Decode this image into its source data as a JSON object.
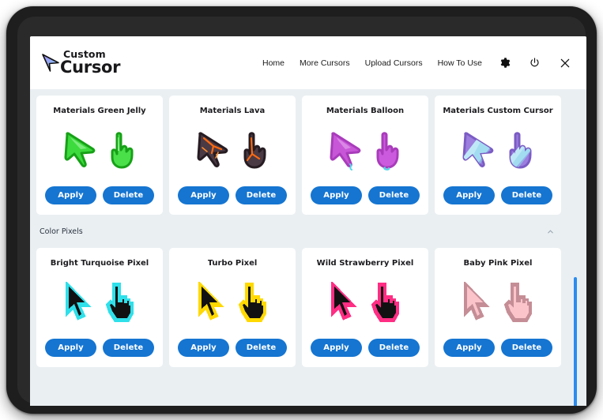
{
  "header": {
    "logo": {
      "top": "Custom",
      "bottom": "Cursor",
      "icon": "cursor-arrow-logo"
    },
    "nav": [
      {
        "label": "Home",
        "name": "nav-home"
      },
      {
        "label": "More Cursors",
        "name": "nav-more-cursors"
      },
      {
        "label": "Upload Cursors",
        "name": "nav-upload-cursors"
      },
      {
        "label": "How To Use",
        "name": "nav-how-to-use"
      }
    ],
    "icons": [
      {
        "name": "gear-icon",
        "label": "Settings"
      },
      {
        "name": "power-icon",
        "label": "Power"
      },
      {
        "name": "close-icon",
        "label": "Close"
      }
    ]
  },
  "buttons": {
    "apply": "Apply",
    "delete": "Delete"
  },
  "sections": [
    {
      "title": null,
      "cards": [
        {
          "title": "Materials Green Jelly",
          "style": "jelly",
          "arrow_fill": "#3ddb3d",
          "arrow_stroke": "#17a117",
          "hand_fill": "#4ae04a",
          "hand_stroke": "#17a117"
        },
        {
          "title": "Materials Lava",
          "style": "jelly",
          "arrow_fill": "#4a3a44",
          "arrow_stroke": "#2a1f26",
          "hand_fill": "#4a3a44",
          "hand_stroke": "#2a1f26"
        },
        {
          "title": "Materials Balloon",
          "style": "jelly",
          "arrow_fill": "#c857d8",
          "arrow_stroke": "#a93cbb",
          "hand_fill": "#cc5ade",
          "hand_stroke": "#a93cbb"
        },
        {
          "title": "Materials Custom Cursor",
          "style": "jelly",
          "arrow_fill": "#9b7ede",
          "arrow_stroke": "#7b5cc4",
          "hand_fill": "#9b7ede",
          "hand_stroke": "#7b5cc4"
        }
      ]
    },
    {
      "title": "Color Pixels",
      "collapse_icon": "chevron-up-icon",
      "cards": [
        {
          "title": "Bright Turquoise Pixel",
          "style": "pixel",
          "fill": "#111111",
          "outline": "#2fe0ea"
        },
        {
          "title": "Turbo Pixel",
          "style": "pixel",
          "fill": "#111111",
          "outline": "#ffd900"
        },
        {
          "title": "Wild Strawberry Pixel",
          "style": "pixel",
          "fill": "#111111",
          "outline": "#ff2d83"
        },
        {
          "title": "Baby Pink Pixel",
          "style": "pixel",
          "fill": "#fbc4cb",
          "outline": "#c58e96"
        }
      ]
    }
  ],
  "colors": {
    "button_blue": "#1575d1",
    "page_background": "#eaeff2",
    "card_background": "#ffffff",
    "scrollbar": "#2a8cf0",
    "bezel": "#1e1e1e"
  }
}
